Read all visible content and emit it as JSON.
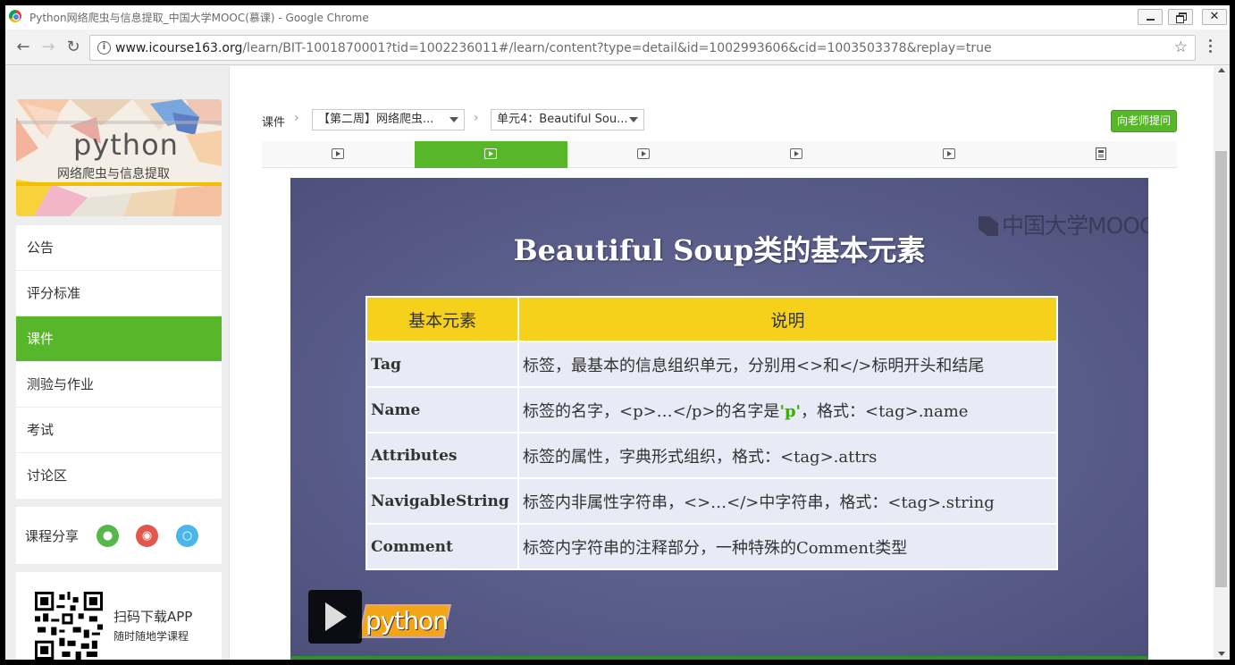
{
  "window": {
    "title": "Python网络爬虫与信息提取_中国大学MOOC(慕课) - Google Chrome",
    "close_glyph": "✕"
  },
  "toolbar": {
    "url_host": "www.icourse163.org",
    "url_path": "/learn/BIT-1001870001?tid=1002236011#/learn/content?type=detail&id=1002993606&cid=1003503378&replay=true"
  },
  "sidebar": {
    "cover_title": "python",
    "cover_subtitle": "网络爬虫与信息提取",
    "nav": [
      {
        "label": "公告"
      },
      {
        "label": "评分标准"
      },
      {
        "label": "课件",
        "active": true
      },
      {
        "label": "测验与作业"
      },
      {
        "label": "考试"
      },
      {
        "label": "讨论区"
      }
    ],
    "share_label": "课程分享",
    "app_title": "扫码下载APP",
    "app_subtitle": "随时随地学课程"
  },
  "main": {
    "crumb": "课件",
    "week_select": "【第二周】网络爬虫...",
    "unit_select": "单元4：Beautiful Sou...",
    "ask_button": "向老师提问",
    "tabs": [
      {
        "icon": "video-icon",
        "active": false
      },
      {
        "icon": "video-icon",
        "active": true
      },
      {
        "icon": "video-icon",
        "active": false
      },
      {
        "icon": "video-icon",
        "active": false
      },
      {
        "icon": "video-icon",
        "active": false
      },
      {
        "icon": "document-icon",
        "active": false
      }
    ]
  },
  "slide": {
    "watermark": "中国大学MOOC",
    "title": "Beautiful Soup类的基本元素",
    "header_key": "基本元素",
    "header_desc": "说明",
    "rows": [
      {
        "key": "Tag",
        "desc": "标签，最基本的信息组织单元，分别用<>和</>标明开头和结尾"
      },
      {
        "key": "Name",
        "desc_a": "标签的名字，<p>…</p>的名字是",
        "desc_hl": "'p'",
        "desc_b": "，格式：<tag>.name"
      },
      {
        "key": "Attributes",
        "desc": "标签的属性，字典形式组织，格式：<tag>.attrs"
      },
      {
        "key": "NavigableString",
        "desc": "标签内非属性字符串，<>…</>中字符串，格式：<tag>.string"
      },
      {
        "key": "Comment",
        "desc": "标签内字符串的注释部分，一种特殊的Comment类型"
      }
    ],
    "logo_text": "python"
  },
  "colors": {
    "accent_green": "#57b62a",
    "table_header": "#f5d11c",
    "slide_bg": "#575c87"
  }
}
